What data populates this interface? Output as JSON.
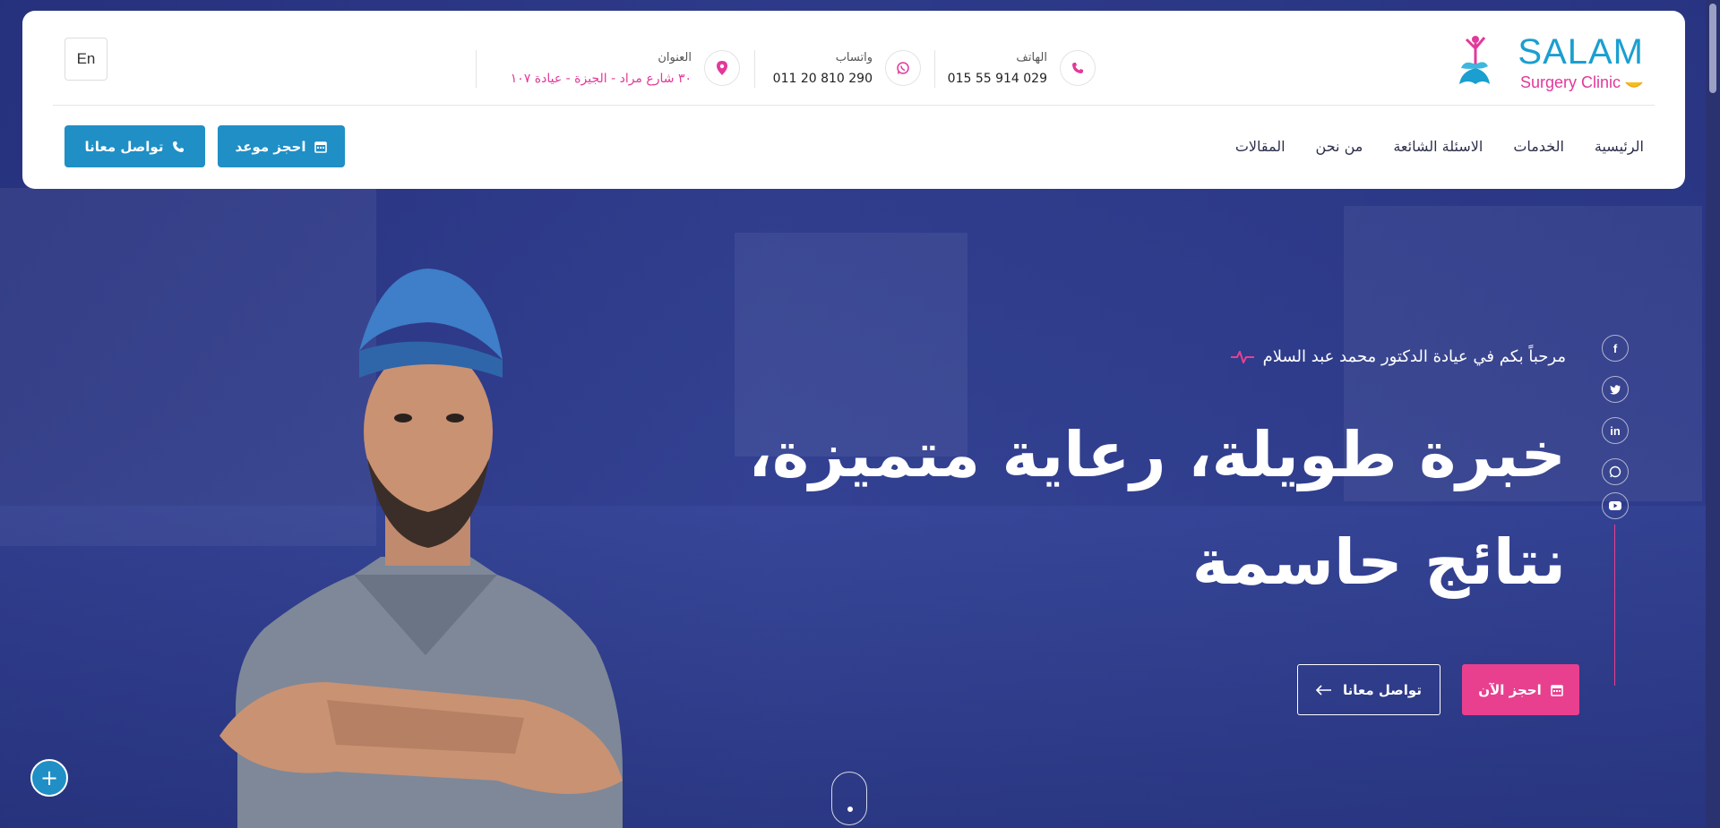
{
  "brand": {
    "name": "SALAM",
    "subtitle": "Surgery Clinic"
  },
  "contacts": [
    {
      "label": "الهاتف",
      "value": "015 55 914 029",
      "icon": "phone-icon"
    },
    {
      "label": "واتساب",
      "value": "011 20 810 290",
      "icon": "whatsapp-icon"
    },
    {
      "label": "العنوان",
      "value": "٣٠ شارع مراد - الجيزة - عيادة ١٠٧",
      "icon": "location-pin-icon"
    }
  ],
  "lang_toggle": "En",
  "nav": [
    "الرئيسية",
    "الخدمات",
    "الاسئلة الشائعة",
    "من نحن",
    "المقالات"
  ],
  "header_buttons": {
    "book": "احجز موعد",
    "contact": "تواصل معانا"
  },
  "hero": {
    "welcome": "مرحباً بكم في عيادة الدكتور محمد عبد السلام",
    "headline_line1": "خبرة طويلة، رعاية متميزة،",
    "headline_line2": "نتائج حاسمة",
    "book_now": "احجز الآن",
    "contact_us": "تواصل معانا"
  },
  "social": [
    "f",
    "twitter",
    "in",
    "whatsapp",
    "youtube"
  ],
  "colors": {
    "accent_blue": "#1f8fc6",
    "accent_pink": "#e8408f",
    "hero_overlay": "#2f3a86"
  }
}
